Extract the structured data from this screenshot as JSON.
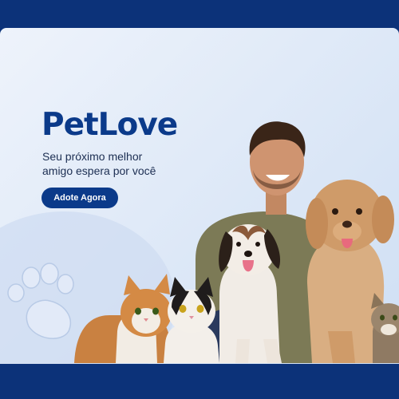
{
  "brand": {
    "name": "PetLove"
  },
  "hero": {
    "tagline_line1": "Seu próximo melhor",
    "tagline_line2": "amigo espera por você",
    "cta_label": "Adote Agora"
  },
  "icons": {
    "decor": "paw-print-icon"
  },
  "colors": {
    "navy": "#0c3279",
    "brand_blue": "#0b3a8a",
    "background": "#e4edf9"
  }
}
